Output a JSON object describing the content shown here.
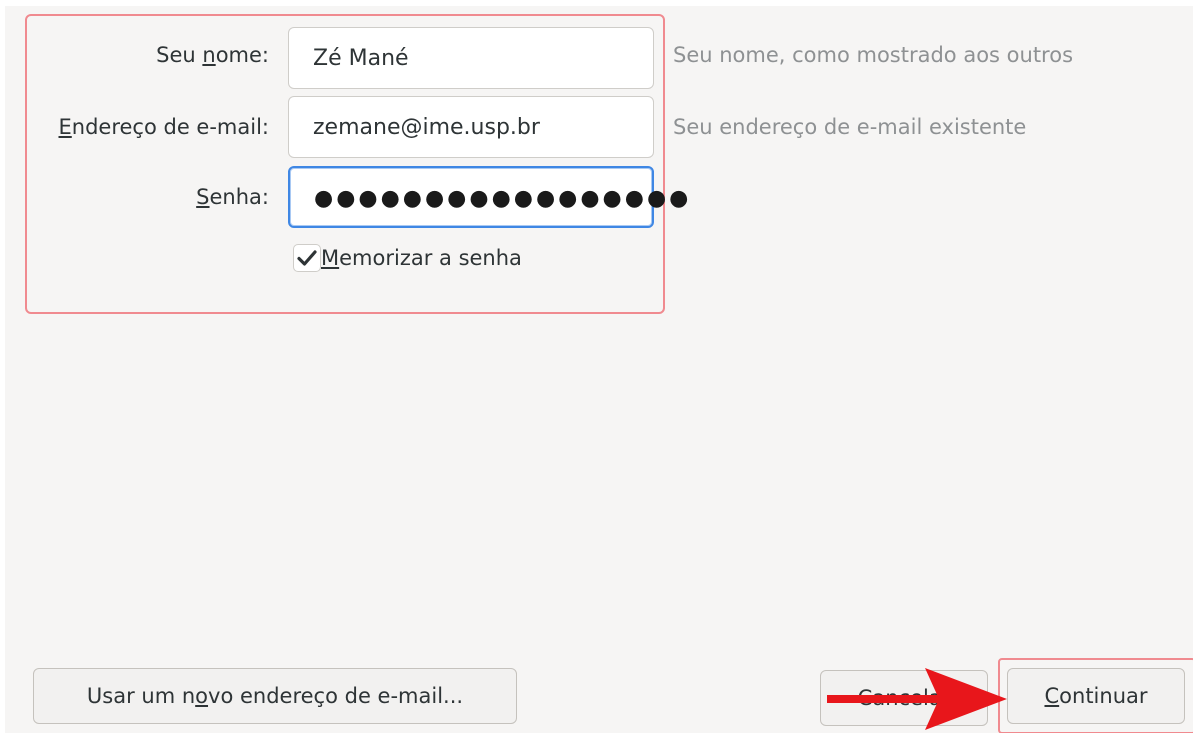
{
  "form": {
    "name": {
      "label_before": "Seu ",
      "label_mnemonic": "n",
      "label_after": "ome:",
      "value": "Zé Mané",
      "hint": "Seu nome, como mostrado aos outros"
    },
    "email": {
      "label_mnemonic": "E",
      "label_after": "ndereço de e-mail:",
      "value": "zemane@ime.usp.br",
      "hint": "Seu endereço de e-mail existente"
    },
    "password": {
      "label_mnemonic": "S",
      "label_after": "enha:",
      "masked_value": "●●●●●●●●●●●●●●●●●"
    },
    "remember": {
      "checked": true,
      "label_mnemonic": "M",
      "label_after": "emorizar a senha"
    }
  },
  "footer": {
    "new_address": {
      "label_before": "Usar um n",
      "label_mnemonic": "o",
      "label_after": "vo endereço de e-mail..."
    },
    "cancel_label": "Cancelar",
    "continue": {
      "label_mnemonic": "C",
      "label_after": "ontinuar"
    }
  },
  "colors": {
    "highlight": "#f08a8f",
    "focus": "#3f87e4",
    "arrow": "#e8161b",
    "hint_text": "#8e9193"
  },
  "icons": {
    "checkbox": "checkmark-icon",
    "annotation": "red-arrow-icon"
  }
}
